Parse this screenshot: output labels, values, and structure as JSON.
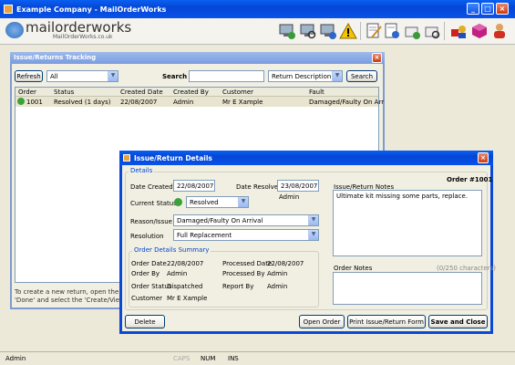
{
  "app": {
    "title": "Example Company - MailOrderWorks",
    "logo_text": "mailorderworks",
    "logo_sub": "MailOrderWorks.co.uk"
  },
  "toolbar": {
    "icons": [
      "computer-add-icon",
      "computer-search-icon",
      "computer-info-icon",
      "warning-icon",
      "notepad-edit-icon",
      "notepad-info-icon",
      "box-add-icon",
      "box-search-icon",
      "shapes-icon",
      "cube-icon",
      "users-icon"
    ]
  },
  "tracking": {
    "title": "Issue/Returns Tracking",
    "refresh_label": "Refresh",
    "filter_value": "All",
    "search_label": "Search",
    "search_value": "",
    "search_field_value": "Return Description",
    "search_button": "Search",
    "columns": [
      "Order",
      "Status",
      "Created Date",
      "Created By",
      "Customer",
      "Fault"
    ],
    "rows": [
      {
        "order": "1001",
        "status": "Resolved (1 days)",
        "created": "22/08/2007",
        "by": "Admin",
        "customer": "Mr E Xample",
        "fault": "Damaged/Faulty On Arr"
      }
    ],
    "help_line1": "To create a new return, open the re",
    "help_line2": "'Done' and select the 'Create/View D"
  },
  "details": {
    "title": "Issue/Return Details",
    "group_label": "Details",
    "order_label": "Order #1001",
    "date_created_label": "Date Created",
    "date_created": "22/08/2007",
    "date_resolved_label": "Date Resolved",
    "date_resolved": "23/08/2007",
    "resolved_by": "Admin",
    "status_label": "Current Status",
    "status_value": "Resolved",
    "reason_label": "Reason/Issue",
    "reason_value": "Damaged/Faulty On Arrival",
    "resolution_label": "Resolution",
    "resolution_value": "Full Replacement",
    "notes_label": "Issue/Return Notes",
    "notes_value": "Ultimate kit missing some parts, replace.",
    "summary_label": "Order Details Summary",
    "order_date_label": "Order Date",
    "order_date": "22/08/2007",
    "processed_date_label": "Processed Date",
    "processed_date": "22/08/2007",
    "order_by_label": "Order By",
    "order_by": "Admin",
    "processed_by_label": "Processed By",
    "processed_by": "Admin",
    "order_status_label": "Order Status",
    "order_status": "Dispatched",
    "report_by_label": "Report By",
    "report_by": "Admin",
    "customer_label": "Customer",
    "customer": "Mr E Xample",
    "order_notes_label": "Order Notes",
    "char_count": "(0/250 characters)",
    "delete_button": "Delete",
    "open_order_button": "Open Order",
    "print_button": "Print Issue/Return Form",
    "save_button": "Save and Close"
  },
  "statusbar": {
    "user": "Admin",
    "caps": "CAPS",
    "num": "NUM",
    "ins": "INS"
  }
}
